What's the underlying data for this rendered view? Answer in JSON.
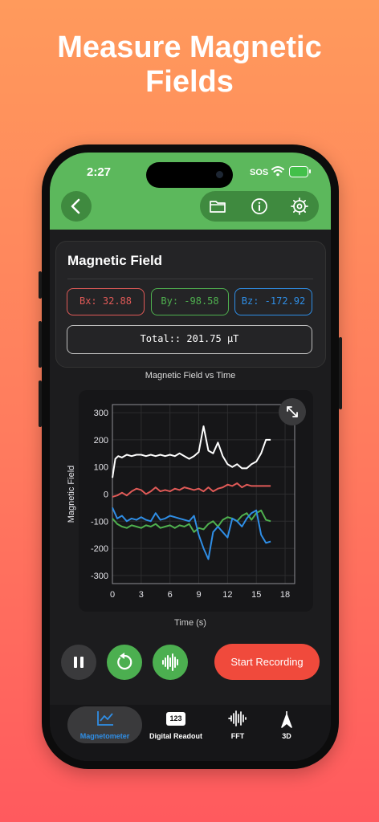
{
  "headline": {
    "line1": "Measure Magnetic",
    "line2": "Fields"
  },
  "status_bar": {
    "time": "2:27",
    "carrier": "SOS"
  },
  "toolbar": {
    "icons": [
      "back-icon",
      "folder-icon",
      "info-icon",
      "settings-icon"
    ]
  },
  "card": {
    "title": "Magnetic Field",
    "bx": "Bx: 32.88",
    "by": "By: -98.58",
    "bz": "Bz: -172.92",
    "total": "Total:: 201.75 μT"
  },
  "colors": {
    "accent_green": "#5cb85c",
    "bx": "#e05a57",
    "by": "#4fb04f",
    "bz": "#2f8ee6",
    "total": "#ffffff",
    "record": "#f04a3c"
  },
  "chart_data": {
    "type": "line",
    "title": "Magnetic Field vs Time",
    "xlabel": "Time (s)",
    "ylabel": "Magnetic Field",
    "xlim": [
      0,
      19
    ],
    "ylim": [
      -330,
      330
    ],
    "xticks": [
      0,
      3,
      6,
      9,
      12,
      15,
      18
    ],
    "yticks": [
      300,
      200,
      100,
      0,
      -100,
      -200,
      -300
    ],
    "grid": true,
    "series": [
      {
        "color": "#ffffff",
        "x": [
          0,
          0.3,
          0.6,
          1,
          1.5,
          2,
          2.5,
          3,
          3.5,
          4,
          4.5,
          5,
          5.5,
          6,
          6.5,
          7,
          7.5,
          8,
          8.5,
          9,
          9.5,
          10,
          10.5,
          11,
          11.5,
          12,
          12.5,
          13,
          13.5,
          14,
          14.5,
          15,
          15.5,
          16,
          16.5
        ],
        "y": [
          60,
          130,
          140,
          135,
          145,
          140,
          145,
          145,
          140,
          145,
          140,
          145,
          140,
          145,
          140,
          150,
          140,
          130,
          140,
          155,
          250,
          160,
          150,
          190,
          140,
          110,
          100,
          110,
          95,
          95,
          110,
          120,
          150,
          200,
          200
        ]
      },
      {
        "color": "#e05a57",
        "x": [
          0,
          0.5,
          1,
          1.5,
          2,
          2.5,
          3,
          3.5,
          4,
          4.5,
          5,
          5.5,
          6,
          6.5,
          7,
          7.5,
          8,
          8.5,
          9,
          9.5,
          10,
          10.5,
          11,
          11.5,
          12,
          12.5,
          13,
          13.5,
          14,
          14.5,
          15,
          15.5,
          16,
          16.5
        ],
        "y": [
          -10,
          -5,
          5,
          -5,
          10,
          20,
          15,
          0,
          10,
          25,
          10,
          15,
          10,
          20,
          15,
          25,
          20,
          15,
          20,
          10,
          25,
          10,
          20,
          25,
          35,
          30,
          40,
          25,
          35,
          30,
          30,
          30,
          30,
          30
        ]
      },
      {
        "color": "#4fb04f",
        "x": [
          0,
          0.5,
          1,
          1.5,
          2,
          2.5,
          3,
          3.5,
          4,
          4.5,
          5,
          5.5,
          6,
          6.5,
          7,
          7.5,
          8,
          8.5,
          9,
          9.5,
          10,
          10.5,
          11,
          11.5,
          12,
          12.5,
          13,
          13.5,
          14,
          14.5,
          15,
          15.5,
          16,
          16.5
        ],
        "y": [
          -90,
          -110,
          -120,
          -125,
          -115,
          -120,
          -125,
          -115,
          -120,
          -110,
          -125,
          -120,
          -115,
          -125,
          -115,
          -120,
          -110,
          -140,
          -125,
          -130,
          -110,
          -100,
          -120,
          -95,
          -85,
          -90,
          -100,
          -80,
          -70,
          -95,
          -70,
          -60,
          -95,
          -100
        ]
      },
      {
        "color": "#2f8ee6",
        "x": [
          0,
          0.5,
          1,
          1.5,
          2,
          2.5,
          3,
          3.5,
          4,
          4.5,
          5,
          5.5,
          6,
          6.5,
          7,
          7.5,
          8,
          8.5,
          9,
          9.5,
          10,
          10.5,
          11,
          11.5,
          12,
          12.5,
          13,
          13.5,
          14,
          14.5,
          15,
          15.5,
          16,
          16.5
        ],
        "y": [
          -50,
          -90,
          -80,
          -100,
          -90,
          -95,
          -85,
          -95,
          -100,
          -70,
          -95,
          -90,
          -80,
          -85,
          -90,
          -95,
          -100,
          -80,
          -150,
          -200,
          -240,
          -140,
          -120,
          -140,
          -160,
          -90,
          -100,
          -120,
          -90,
          -70,
          -60,
          -150,
          -180,
          -175
        ]
      }
    ]
  },
  "controls": {
    "record_label": "Start Recording"
  },
  "tabs": [
    {
      "label": "Magnetometer"
    },
    {
      "label": "Digital Readout",
      "badge": "123"
    },
    {
      "label": "FFT"
    },
    {
      "label": "3D"
    }
  ]
}
